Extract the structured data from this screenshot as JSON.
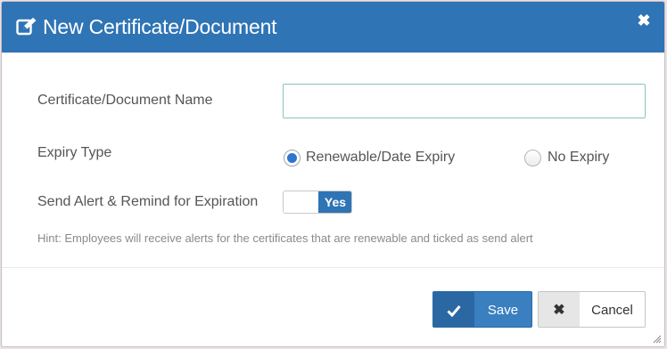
{
  "dialog": {
    "title": "New Certificate/Document",
    "title_icon": "edit-icon",
    "close_icon": "close-icon"
  },
  "form": {
    "name_label": "Certificate/Document Name",
    "name_value": "",
    "name_placeholder": "",
    "expiry_label": "Expiry Type",
    "expiry_options": [
      {
        "label": "Renewable/Date Expiry",
        "selected": true
      },
      {
        "label": "No Expiry",
        "selected": false
      }
    ],
    "alert_label": "Send Alert & Remind for Expiration",
    "alert_toggle": "Yes",
    "hint": "Hint: Employees will receive alerts for the certificates that are renewable and ticked as send alert"
  },
  "footer": {
    "save_label": "Save",
    "save_icon": "check-icon",
    "cancel_label": "Cancel",
    "cancel_icon": "times-icon"
  },
  "colors": {
    "header_bg": "#2f74b5",
    "primary": "#3a7fc0",
    "radio_checked": "#2f74d0"
  }
}
